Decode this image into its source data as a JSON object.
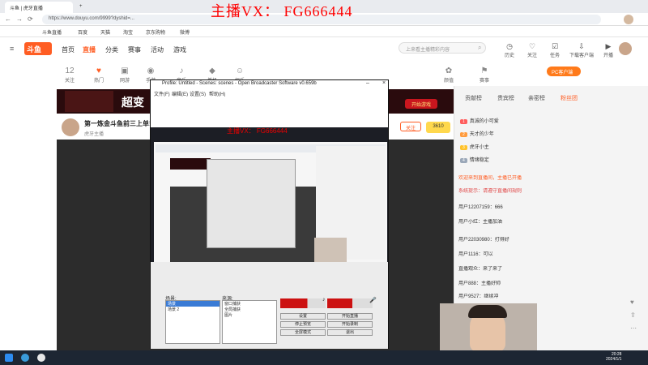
{
  "watermark": "主播VX： FG666444",
  "browser": {
    "tabs": [
      "斗鱼 | 虎牙直播",
      "虎牙直播",
      "+"
    ],
    "address": "https://www.douyu.com/9999?dyshid=...",
    "bookmarks": [
      "斗鱼直播",
      "百度",
      "天猫",
      "淘宝",
      "京东购物",
      "微博",
      "虎牙直播",
      "哔哩哔哩"
    ]
  },
  "site": {
    "logo": "斗鱼",
    "nav": [
      "首页",
      "直播",
      "分类",
      "赛事",
      "活动",
      "游戏"
    ],
    "search_placeholder": "上来看主播精彩内容",
    "tools": [
      "历史",
      "关注",
      "任务",
      "下载客户端",
      "开播"
    ],
    "pc_client": "PC客户端",
    "categories": [
      {
        "icon": "12",
        "label": "关注"
      },
      {
        "icon": "♥",
        "label": "热门"
      },
      {
        "icon": "▣",
        "label": "网游"
      },
      {
        "icon": "◉",
        "label": "手游"
      },
      {
        "icon": "♪",
        "label": "音乐"
      },
      {
        "icon": "◆",
        "label": "单机"
      },
      {
        "icon": "☺",
        "label": "娱乐"
      },
      {
        "icon": "✿",
        "label": "颜值"
      },
      {
        "icon": "⚑",
        "label": "赛事"
      }
    ]
  },
  "room": {
    "banner": "超变",
    "banner_btn": "开始游戏",
    "title": "第一炼金斗鱼前三上单!",
    "anchor": "虎牙主播",
    "follow": "关注",
    "follow_count": "3610"
  },
  "right": {
    "tabs": [
      "贡献榜",
      "贵宾榜",
      "亲密榜",
      "粉丝团"
    ],
    "rank": [
      {
        "badge": "1",
        "name": "真诚的小可爱",
        "color": "#ff5d5d"
      },
      {
        "badge": "2",
        "name": "天才的少年",
        "color": "#ff9b3d"
      },
      {
        "badge": "3",
        "name": "虎牙小主",
        "color": "#ffc22a"
      },
      {
        "badge": "4",
        "name": "情绪稳定",
        "color": "#9aa7b8"
      }
    ],
    "chat": [
      "欢迎来到直播间，主播已开播",
      "系统提示：请遵守直播间规则",
      "用户12207159：666",
      "用户小红：主播加油",
      "用户22030980：打得好",
      "用户1116：可以",
      "直播观众：来了来了",
      "用户888：主播好帅",
      "用户9527：继续冲"
    ]
  },
  "obs": {
    "title": "Profile: Untitled - Scenes: scenes - Open Broadcaster Software v0.659b",
    "menu": [
      "文件(F)",
      "编辑(E)",
      "设置(S)",
      "帮助(H)"
    ],
    "scenes_label": "场景:",
    "sources_label": "来源:",
    "scenes": [
      "场景",
      "场景 2"
    ],
    "sources": [
      "窗口捕获",
      "全局捕获",
      "图片"
    ],
    "buttons": [
      "设置",
      "开始直播",
      "停止预览",
      "开始录制",
      "全屏模式",
      "退出"
    ]
  },
  "taskbar": {
    "time": "20:28",
    "date": "2024/1/1"
  }
}
